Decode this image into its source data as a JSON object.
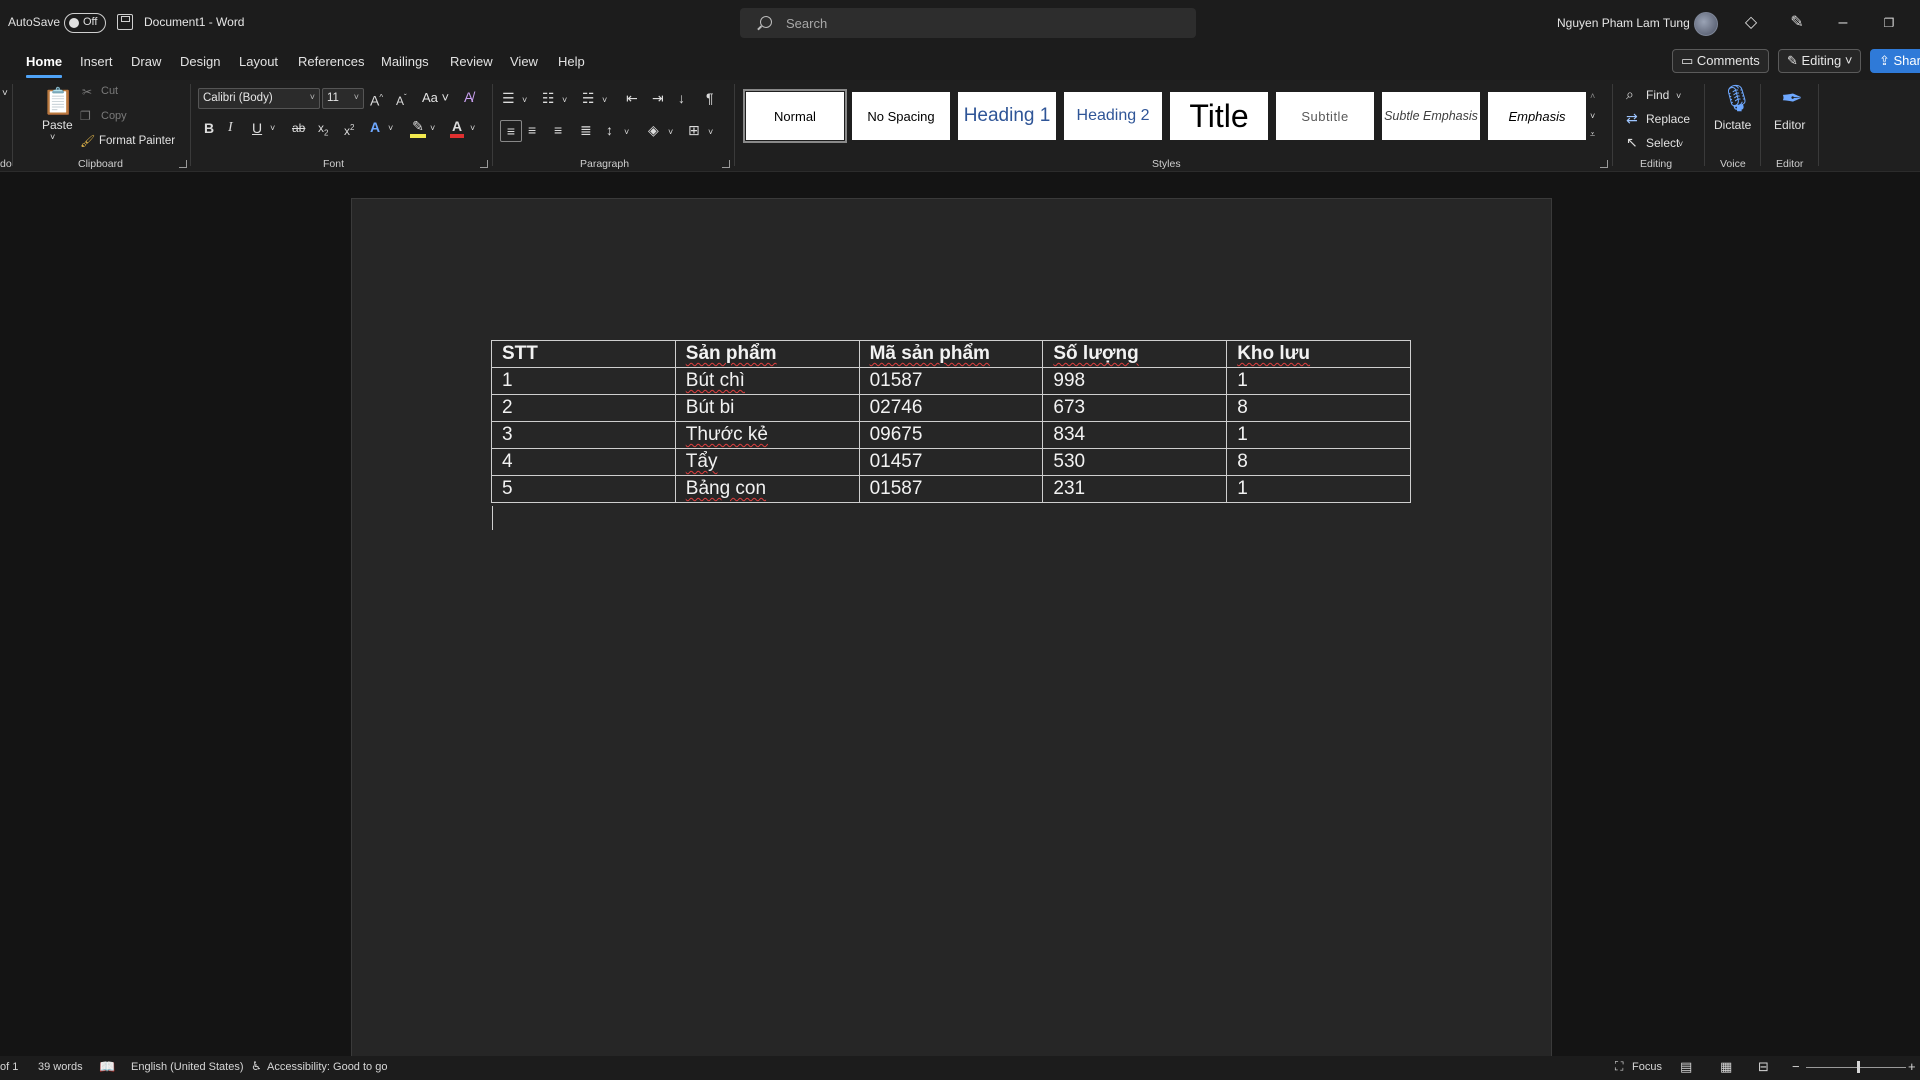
{
  "titlebar": {
    "autosave_label": "AutoSave",
    "autosave_state": "Off",
    "document_name": "Document1  -  Word",
    "search_placeholder": "Search",
    "user_name": "Nguyen Pham Lam Tung"
  },
  "tabs": [
    {
      "label": "Home",
      "active": true
    },
    {
      "label": "Insert"
    },
    {
      "label": "Draw"
    },
    {
      "label": "Design"
    },
    {
      "label": "Layout"
    },
    {
      "label": "References"
    },
    {
      "label": "Mailings"
    },
    {
      "label": "Review"
    },
    {
      "label": "View"
    },
    {
      "label": "Help"
    }
  ],
  "header_buttons": {
    "comments": "Comments",
    "editing": "Editing",
    "share": "Shar"
  },
  "ribbon": {
    "clipboard": {
      "label": "Clipboard",
      "paste": "Paste",
      "cut": "Cut",
      "copy": "Copy",
      "format_painter": "Format Painter",
      "undo_partial": "do"
    },
    "font": {
      "label": "Font",
      "font_name": "Calibri (Body)",
      "font_size": "11",
      "change_case": "Aa"
    },
    "paragraph": {
      "label": "Paragraph"
    },
    "styles": {
      "label": "Styles",
      "items": [
        "Normal",
        "No Spacing",
        "Heading 1",
        "Heading 2",
        "Title",
        "Subtitle",
        "Subtle Emphasis",
        "Emphasis"
      ]
    },
    "editing": {
      "label": "Editing",
      "find": "Find",
      "replace": "Replace",
      "select": "Select"
    },
    "voice": {
      "label": "Voice",
      "dictate": "Dictate"
    },
    "editor": {
      "label": "Editor",
      "editor": "Editor"
    }
  },
  "document": {
    "table": {
      "headers": [
        "STT",
        "Sản phẩm",
        "Mã sản phẩm",
        "Số lượng",
        "Kho lưu"
      ],
      "rows": [
        [
          "1",
          "Bút chì",
          "01587",
          "998",
          "1"
        ],
        [
          "2",
          "Bút bi",
          "02746",
          "673",
          "8"
        ],
        [
          "3",
          "Thước kẻ",
          "09675",
          "834",
          "1"
        ],
        [
          "4",
          "Tẩy",
          "01457",
          "530",
          "8"
        ],
        [
          "5",
          "Bảng con",
          "01587",
          "231",
          "1"
        ]
      ]
    }
  },
  "statusbar": {
    "page": "of 1",
    "words": "39 words",
    "language": "English (United States)",
    "accessibility": "Accessibility: Good to go",
    "focus": "Focus",
    "zoom_minus": "−",
    "zoom_plus": "+"
  }
}
